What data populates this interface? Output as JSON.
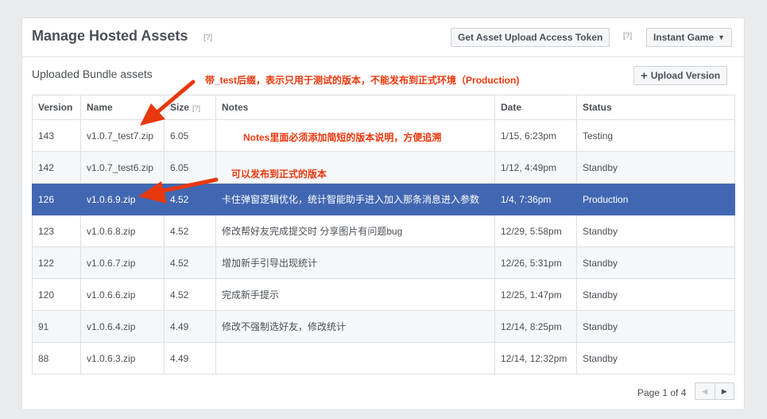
{
  "header": {
    "title": "Manage Hosted Assets",
    "help": "[?]",
    "token_button": "Get Asset Upload Access Token",
    "token_help": "[?]",
    "game_dropdown": "Instant Game"
  },
  "section": {
    "title": "Uploaded Bundle assets",
    "upload_button": "Upload Version"
  },
  "table": {
    "columns": [
      "Version",
      "Name",
      "Size",
      "Notes",
      "Date",
      "Status"
    ],
    "size_help": "[?]",
    "rows": [
      {
        "version": "143",
        "name": "v1.0.7_test7.zip",
        "size": "6.05",
        "notes": "",
        "date": "1/15, 6:23pm",
        "status": "Testing"
      },
      {
        "version": "142",
        "name": "v1.0.7_test6.zip",
        "size": "6.05",
        "notes": "",
        "date": "1/12, 4:49pm",
        "status": "Standby"
      },
      {
        "version": "126",
        "name": "v1.0.6.9.zip",
        "size": "4.52",
        "notes": "卡住弹窗逻辑优化，统计智能助手进入加入那条消息进入参数",
        "date": "1/4, 7:36pm",
        "status": "Production"
      },
      {
        "version": "123",
        "name": "v1.0.6.8.zip",
        "size": "4.52",
        "notes": "修改帮好友完成提交时 分享图片有问题bug",
        "date": "12/29, 5:58pm",
        "status": "Standby"
      },
      {
        "version": "122",
        "name": "v1.0.6.7.zip",
        "size": "4.52",
        "notes": "增加新手引导出现统计",
        "date": "12/26, 5:31pm",
        "status": "Standby"
      },
      {
        "version": "120",
        "name": "v1.0.6.6.zip",
        "size": "4.52",
        "notes": "完成新手提示",
        "date": "12/25, 1:47pm",
        "status": "Standby"
      },
      {
        "version": "91",
        "name": "v1.0.6.4.zip",
        "size": "4.49",
        "notes": "修改不强制选好友，修改统计",
        "date": "12/14, 8:25pm",
        "status": "Standby"
      },
      {
        "version": "88",
        "name": "v1.0.6.3.zip",
        "size": "4.49",
        "notes": "",
        "date": "12/14, 12:32pm",
        "status": "Standby"
      }
    ]
  },
  "pager": {
    "label": "Page 1 of 4",
    "prev_icon": "chevron-left-icon",
    "next_icon": "chevron-right-icon"
  },
  "annotations": {
    "test_suffix": "带_test后缀，表示只用于测试的版本，不能发布到正式环境（Production)",
    "notes_required": "Notes里面必须添加简短的版本说明，方便追溯",
    "publishable": "可以发布到正式的版本"
  },
  "colors": {
    "selected_row": "#4267b2",
    "annotation": "#e8380d",
    "background": "#e9ebee"
  }
}
